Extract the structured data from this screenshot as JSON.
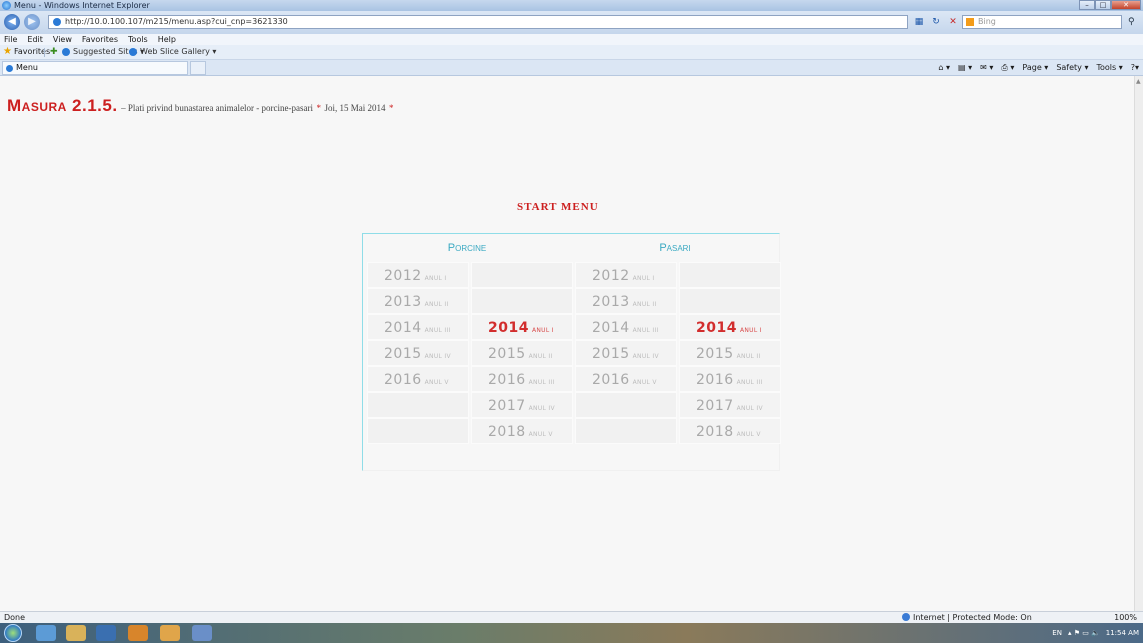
{
  "window": {
    "title": "Menu - Windows Internet Explorer",
    "controls": [
      "–",
      "□",
      "✕"
    ]
  },
  "address_bar": {
    "url": "http://10.0.100.107/m215/menu.asp?cui_cnp=3621330",
    "search_placeholder": "Bing"
  },
  "menu_bar": [
    "File",
    "Edit",
    "View",
    "Favorites",
    "Tools",
    "Help"
  ],
  "favorites_bar": {
    "favorites": "Favorites",
    "suggested_sites": "Suggested Sites ▾",
    "web_slice_gallery": "Web Slice Gallery ▾"
  },
  "tab": {
    "label": "Menu"
  },
  "command_bar": [
    "Page ▾",
    "Safety ▾",
    "Tools ▾"
  ],
  "page": {
    "title": "Masura 2.1.5.",
    "subtitle": "– Plati privind bunastarea animalelor - porcine-pasari",
    "star_open": "*",
    "date": "Joi, 15 Mai 2014",
    "star_close": "*",
    "menu_heading": "START MENU"
  },
  "grid": {
    "porcine_label": "Porcine",
    "pasari_label": "Pasari",
    "rows": [
      [
        {
          "year": "2012",
          "anul": "ANUL I"
        },
        null,
        {
          "year": "2012",
          "anul": "ANUL I"
        },
        null
      ],
      [
        {
          "year": "2013",
          "anul": "ANUL II"
        },
        null,
        {
          "year": "2013",
          "anul": "ANUL II"
        },
        null
      ],
      [
        {
          "year": "2014",
          "anul": "ANUL III"
        },
        {
          "year": "2014",
          "anul": "ANUL I",
          "active": true
        },
        {
          "year": "2014",
          "anul": "ANUL III"
        },
        {
          "year": "2014",
          "anul": "ANUL I",
          "active": true
        }
      ],
      [
        {
          "year": "2015",
          "anul": "ANUL IV"
        },
        {
          "year": "2015",
          "anul": "ANUL II"
        },
        {
          "year": "2015",
          "anul": "ANUL IV"
        },
        {
          "year": "2015",
          "anul": "ANUL II"
        }
      ],
      [
        {
          "year": "2016",
          "anul": "ANUL V"
        },
        {
          "year": "2016",
          "anul": "ANUL III"
        },
        {
          "year": "2016",
          "anul": "ANUL V"
        },
        {
          "year": "2016",
          "anul": "ANUL III"
        }
      ],
      [
        null,
        {
          "year": "2017",
          "anul": "ANUL IV"
        },
        null,
        {
          "year": "2017",
          "anul": "ANUL IV"
        }
      ],
      [
        null,
        {
          "year": "2018",
          "anul": "ANUL V"
        },
        null,
        {
          "year": "2018",
          "anul": "ANUL V"
        }
      ]
    ]
  },
  "status_bar": {
    "status": "Done",
    "zone": "Internet | Protected Mode: On",
    "zoom": "100%"
  },
  "taskbar": {
    "language": "EN",
    "time": "11:54 AM"
  },
  "colors": {
    "accent_red": "#cc1f1f",
    "header_cyan": "#3aa9c2",
    "border_cyan": "#8fdde8",
    "inactive_gray": "#a9a9a9"
  }
}
